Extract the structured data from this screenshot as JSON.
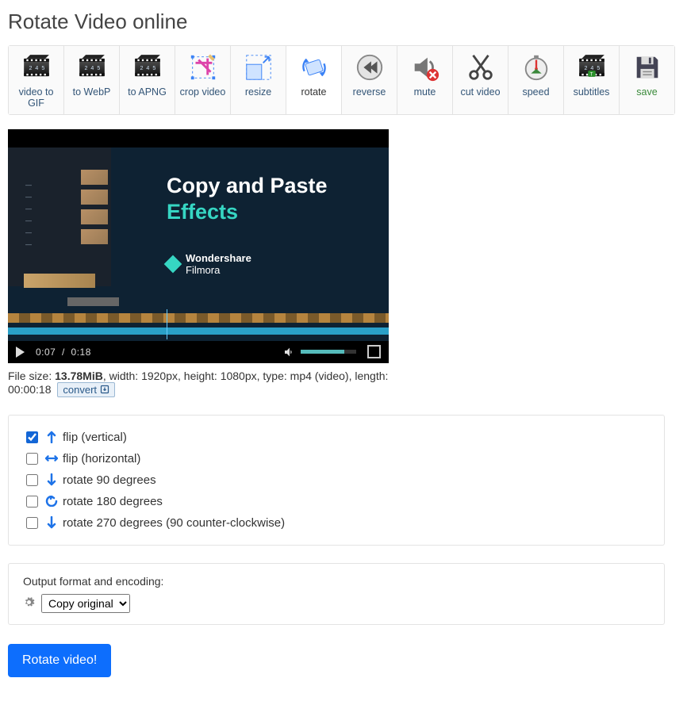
{
  "title": "Rotate Video online",
  "toolbar": [
    {
      "key": "gif",
      "label": "video to\nGIF"
    },
    {
      "key": "webp",
      "label": "to WebP"
    },
    {
      "key": "apng",
      "label": "to APNG"
    },
    {
      "key": "crop",
      "label": "crop video"
    },
    {
      "key": "resize",
      "label": "resize"
    },
    {
      "key": "rotate",
      "label": "rotate",
      "selected": true
    },
    {
      "key": "reverse",
      "label": "reverse"
    },
    {
      "key": "mute",
      "label": "mute"
    },
    {
      "key": "cut",
      "label": "cut video"
    },
    {
      "key": "speed",
      "label": "speed"
    },
    {
      "key": "subtitles",
      "label": "subtitles"
    },
    {
      "key": "save",
      "label": "save"
    }
  ],
  "video": {
    "promo_line1": "Copy and Paste",
    "promo_line2": "Effects",
    "brand_line1": "Wondershare",
    "brand_line2": "Filmora",
    "time_current": "0:07",
    "time_sep": "/",
    "time_total": "0:18"
  },
  "info": {
    "prefix": "File size: ",
    "size": "13.78MiB",
    "rest": ", width: 1920px, height: 1080px, type: mp4 (video), length: 00:00:18",
    "convert_label": "convert"
  },
  "options": [
    {
      "key": "flipv",
      "label": "flip (vertical)",
      "checked": true,
      "icon": "up"
    },
    {
      "key": "fliph",
      "label": "flip (horizontal)",
      "checked": false,
      "icon": "lr"
    },
    {
      "key": "rot90",
      "label": "rotate 90 degrees",
      "checked": false,
      "icon": "dr"
    },
    {
      "key": "rot180",
      "label": "rotate 180 degrees",
      "checked": false,
      "icon": "cc"
    },
    {
      "key": "rot270",
      "label": "rotate 270 degrees (90 counter-clockwise)",
      "checked": false,
      "icon": "dl"
    }
  ],
  "output": {
    "heading": "Output format and encoding:",
    "selected": "Copy original"
  },
  "submit_label": "Rotate video!"
}
